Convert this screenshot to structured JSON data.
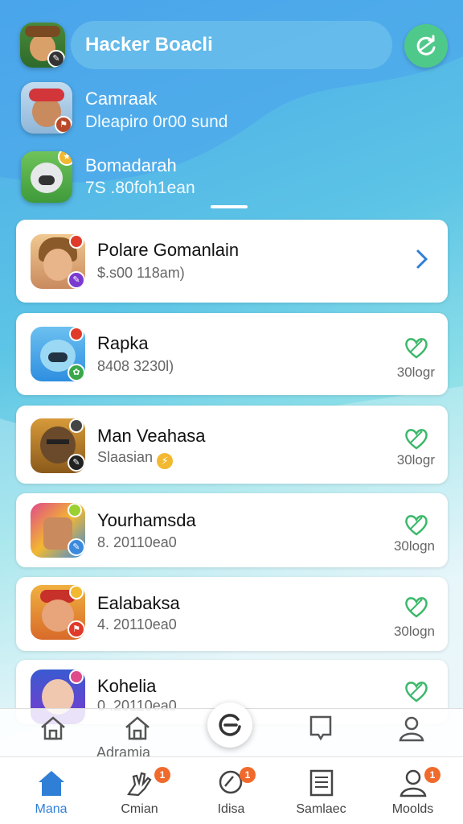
{
  "header": {
    "search_label": "Hacker Boacli",
    "friends": [
      {
        "name": "Camraak",
        "sub": "Dleapiro 0r00 sund"
      },
      {
        "name": "Bomadarah",
        "sub": "7S .80foh1ean"
      }
    ]
  },
  "list": [
    {
      "title": "Polare Gomanlain",
      "subtitle": "$.s00 118am)",
      "action": "chevron"
    },
    {
      "title": "Rapka",
      "subtitle": "8408 3230l)",
      "action": "heart",
      "meta": "30logr"
    },
    {
      "title": "Man Veahasa",
      "subtitle": "Slaasian",
      "action": "heart",
      "meta": "30logr"
    },
    {
      "title": "Yourhamsda",
      "subtitle": "8. 20110ea0",
      "action": "heart",
      "meta": "30logn"
    },
    {
      "title": "Ealabaksa",
      "subtitle": "4. 20110ea0",
      "action": "heart",
      "meta": "30logn"
    },
    {
      "title": "Kohelia",
      "subtitle": "0 .20110ea0",
      "action": "heart"
    }
  ],
  "float_bar": {
    "label": "Adramia"
  },
  "bottom_nav": [
    {
      "label": "Mana",
      "icon": "home-icon",
      "active": true
    },
    {
      "label": "Cmian",
      "icon": "hand-icon",
      "badge": "1"
    },
    {
      "label": "Idisa",
      "icon": "search-icon",
      "badge": "1"
    },
    {
      "label": "Samlaec",
      "icon": "document-icon"
    },
    {
      "label": "Moolds",
      "icon": "person-icon",
      "badge": "1"
    }
  ],
  "colors": {
    "accent": "#2f7fd6",
    "green": "#4fc98a",
    "badge": "#f06a2c"
  }
}
